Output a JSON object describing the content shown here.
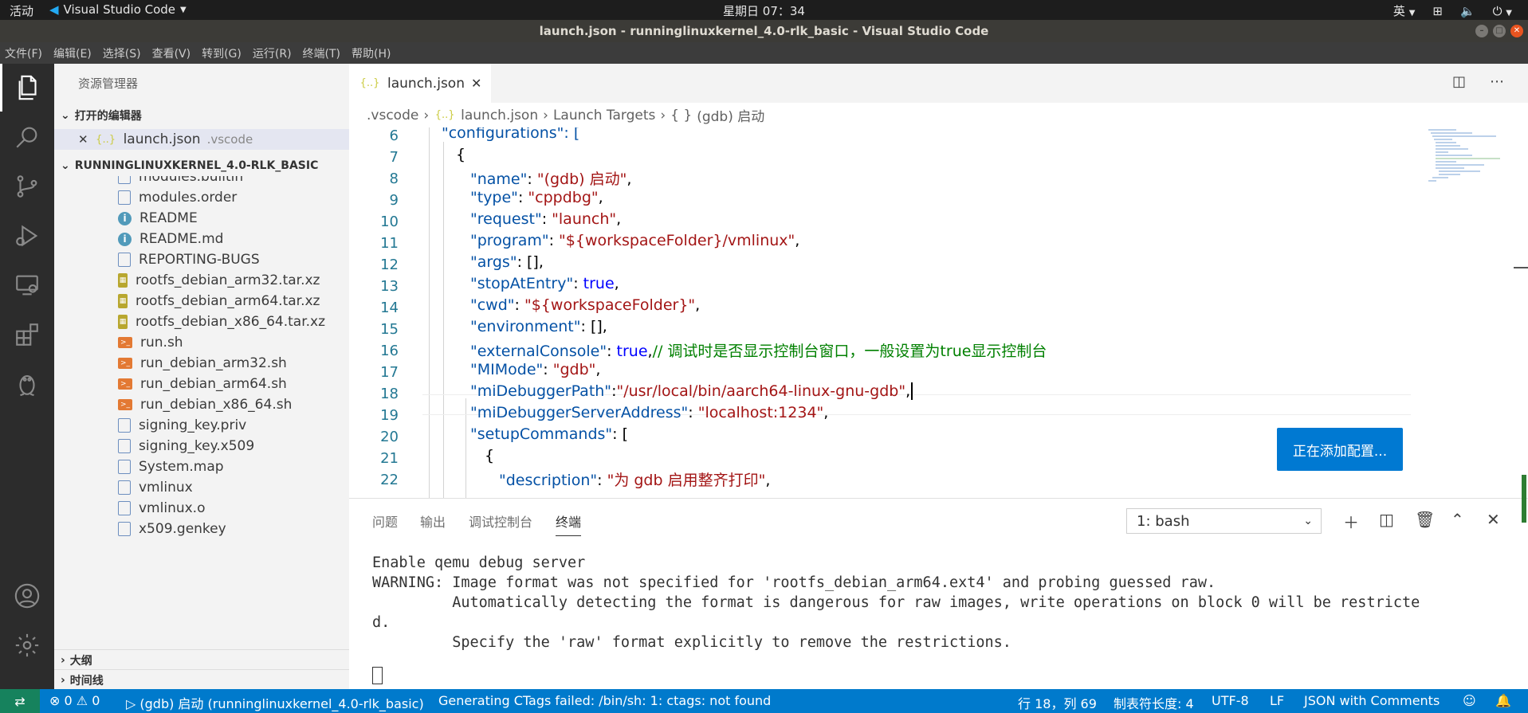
{
  "gnome": {
    "activities": "活动",
    "app": "Visual Studio Code",
    "clock": "星期日 07：34",
    "lang": "英"
  },
  "window_title": "launch.json - runninglinuxkernel_4.0-rlk_basic - Visual Studio Code",
  "menu": [
    "文件(F)",
    "编辑(E)",
    "选择(S)",
    "查看(V)",
    "转到(G)",
    "运行(R)",
    "终端(T)",
    "帮助(H)"
  ],
  "sidebar": {
    "title": "资源管理器",
    "open_editors": "打开的编辑器",
    "open_file": {
      "name": "launch.json",
      "dir": ".vscode"
    },
    "project": "RUNNINGLINUXKERNEL_4.0-RLK_BASIC",
    "files": [
      "modules.builtin",
      "modules.order",
      "README",
      "README.md",
      "REPORTING-BUGS",
      "rootfs_debian_arm32.tar.xz",
      "rootfs_debian_arm64.tar.xz",
      "rootfs_debian_x86_64.tar.xz",
      "run.sh",
      "run_debian_arm32.sh",
      "run_debian_arm64.sh",
      "run_debian_x86_64.sh",
      "signing_key.priv",
      "signing_key.x509",
      "System.map",
      "vmlinux",
      "vmlinux.o",
      "x509.genkey"
    ],
    "outline": "大纲",
    "timeline": "时间线"
  },
  "editor": {
    "tab": "launch.json",
    "breadcrumb": [
      ".vscode",
      "launch.json",
      "Launch Targets",
      "(gdb) 启动"
    ],
    "line_numbers": [
      "6",
      "7",
      "8",
      "9",
      "10",
      "11",
      "12",
      "13",
      "14",
      "15",
      "16",
      "17",
      "18",
      "19",
      "20",
      "21",
      "22"
    ],
    "lines": {
      "l6": "\"configurations\": [",
      "l7": "{",
      "k8": "\"name\"",
      "v8": "\"(gdb) 启动\"",
      "k9": "\"type\"",
      "v9": "\"cppdbg\"",
      "k10": "\"request\"",
      "v10": "\"launch\"",
      "k11": "\"program\"",
      "v11": "\"${workspaceFolder}/vmlinux\"",
      "k12": "\"args\"",
      "v12": "[],",
      "k13": "\"stopAtEntry\"",
      "v13": "true",
      "k14": "\"cwd\"",
      "v14": "\"${workspaceFolder}\"",
      "k15": "\"environment\"",
      "v15": "[],",
      "k16": "\"externalConsole\"",
      "v16": "true",
      "c16": "// 调试时是否显示控制台窗口，一般设置为true显示控制台",
      "k17": "\"MIMode\"",
      "v17": "\"gdb\"",
      "k18": "\"miDebuggerPath\"",
      "v18": "\"/usr/local/bin/aarch64-linux-gnu-gdb\"",
      "k19": "\"miDebuggerServerAddress\"",
      "v19": "\"localhost:1234\"",
      "k20": "\"setupCommands\"",
      "v20": "[",
      "l21": "{",
      "k22": "\"description\"",
      "v22": "\"为 gdb 启用整齐打印\""
    },
    "notification": "正在添加配置..."
  },
  "panel": {
    "tabs": [
      "问题",
      "输出",
      "调试控制台",
      "终端"
    ],
    "terminal_select": "1: bash",
    "terminal_lines": [
      "Enable qemu debug server",
      "WARNING: Image format was not specified for 'rootfs_debian_arm64.ext4' and probing guessed raw.",
      "         Automatically detecting the format is dangerous for raw images, write operations on block 0 will be restricte",
      "d.",
      "         Specify the 'raw' format explicitly to remove the restrictions."
    ]
  },
  "status": {
    "problems": "⊗ 0 ⚠ 0",
    "debug": "(gdb) 启动 (runninglinuxkernel_4.0-rlk_basic)",
    "message": "Generating CTags failed: /bin/sh: 1: ctags: not found",
    "position": "行 18，列 69",
    "tabsize": "制表符长度: 4",
    "encoding": "UTF-8",
    "eol": "LF",
    "language": "JSON with Comments"
  }
}
